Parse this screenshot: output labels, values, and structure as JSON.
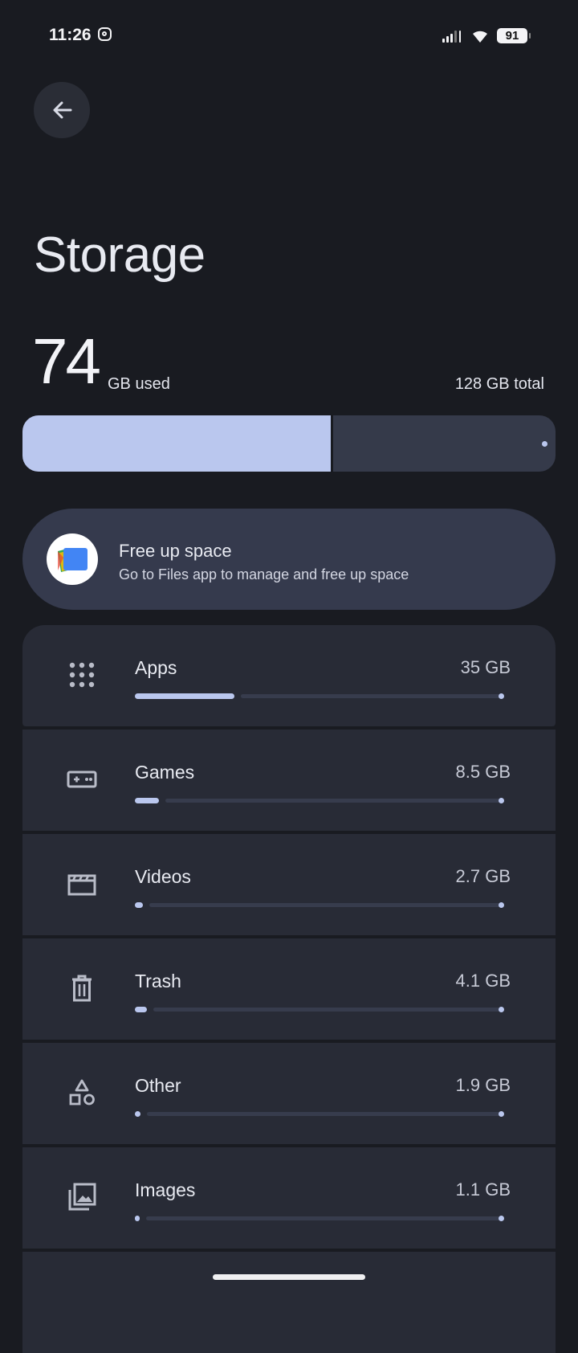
{
  "status_bar": {
    "time": "11:26",
    "battery": "91"
  },
  "page": {
    "title": "Storage"
  },
  "summary": {
    "used_value": "74",
    "used_unit": "GB used",
    "total": "128 GB total",
    "used_fraction": 0.578
  },
  "free_up": {
    "title": "Free up space",
    "subtitle": "Go to Files app to manage and free up space"
  },
  "categories": [
    {
      "label": "Apps",
      "size": "35 GB",
      "fraction": 0.27,
      "icon": "apps-grid-icon"
    },
    {
      "label": "Games",
      "size": "8.5 GB",
      "fraction": 0.066,
      "icon": "gamepad-icon"
    },
    {
      "label": "Videos",
      "size": "2.7 GB",
      "fraction": 0.021,
      "icon": "video-clapper-icon"
    },
    {
      "label": "Trash",
      "size": "4.1 GB",
      "fraction": 0.032,
      "icon": "trash-icon"
    },
    {
      "label": "Other",
      "size": "1.9 GB",
      "fraction": 0.015,
      "icon": "shapes-icon"
    },
    {
      "label": "Images",
      "size": "1.1 GB",
      "fraction": 0.009,
      "icon": "images-icon"
    }
  ],
  "colors": {
    "background": "#191b21",
    "accent": "#bac7ee",
    "card": "#282b36",
    "free_card": "#353a4d"
  }
}
